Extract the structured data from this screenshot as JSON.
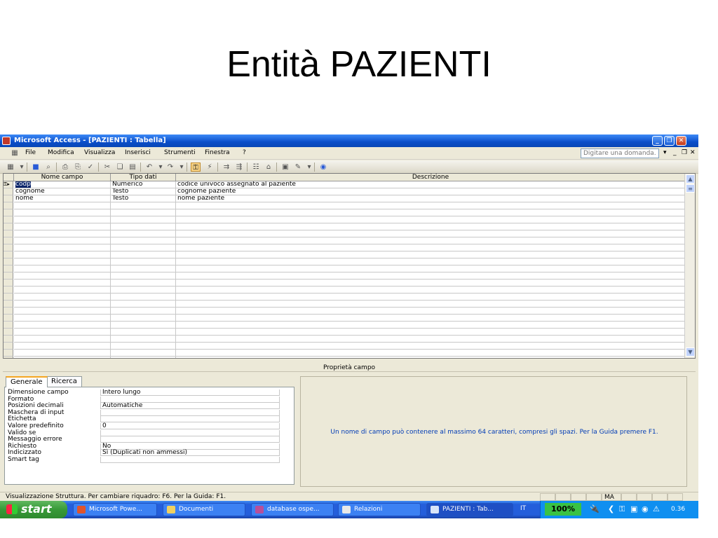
{
  "slide": {
    "title": "Entità PAZIENTI"
  },
  "window": {
    "title": "Microsoft Access - [PAZIENTI : Tabella]",
    "menu": [
      "File",
      "Modifica",
      "Visualizza",
      "Inserisci",
      "Strumenti",
      "Finestra",
      "?"
    ],
    "help_placeholder": "Digitare una domanda."
  },
  "grid": {
    "columns": [
      "Nome campo",
      "Tipo dati",
      "Descrizione"
    ],
    "rows": [
      {
        "name": "codp",
        "type": "Numerico",
        "desc": "codice univoco assegnato al paziente"
      },
      {
        "name": "cognome",
        "type": "Testo",
        "desc": "cognome paziente"
      },
      {
        "name": "nome",
        "type": "Testo",
        "desc": "nome paziente"
      }
    ]
  },
  "properties": {
    "section_label": "Proprietà campo",
    "tabs": [
      "Generale",
      "Ricerca"
    ],
    "rows": [
      {
        "label": "Dimensione campo",
        "value": "Intero lungo"
      },
      {
        "label": "Formato",
        "value": ""
      },
      {
        "label": "Posizioni decimali",
        "value": "Automatiche"
      },
      {
        "label": "Maschera di input",
        "value": ""
      },
      {
        "label": "Etichetta",
        "value": ""
      },
      {
        "label": "Valore predefinito",
        "value": "0"
      },
      {
        "label": "Valido se",
        "value": ""
      },
      {
        "label": "Messaggio errore",
        "value": ""
      },
      {
        "label": "Richiesto",
        "value": "No"
      },
      {
        "label": "Indicizzato",
        "value": "Sì (Duplicati non ammessi)"
      },
      {
        "label": "Smart tag",
        "value": ""
      }
    ],
    "hint": "Un nome di campo può contenere al massimo 64 caratteri, compresi gli spazi. Per la Guida premere F1."
  },
  "status": {
    "text": "Visualizzazione Struttura. Per cambiare riquadro: F6. Per la Guida: F1.",
    "mode": "MA"
  },
  "taskbar": {
    "start": "start",
    "tasks": [
      "Microsoft Powe...",
      "Documenti",
      "database ospe...",
      "Relazioni",
      "PAZIENTI : Tab..."
    ],
    "lang": "IT",
    "zoom": "100%",
    "clock": "0.36"
  }
}
